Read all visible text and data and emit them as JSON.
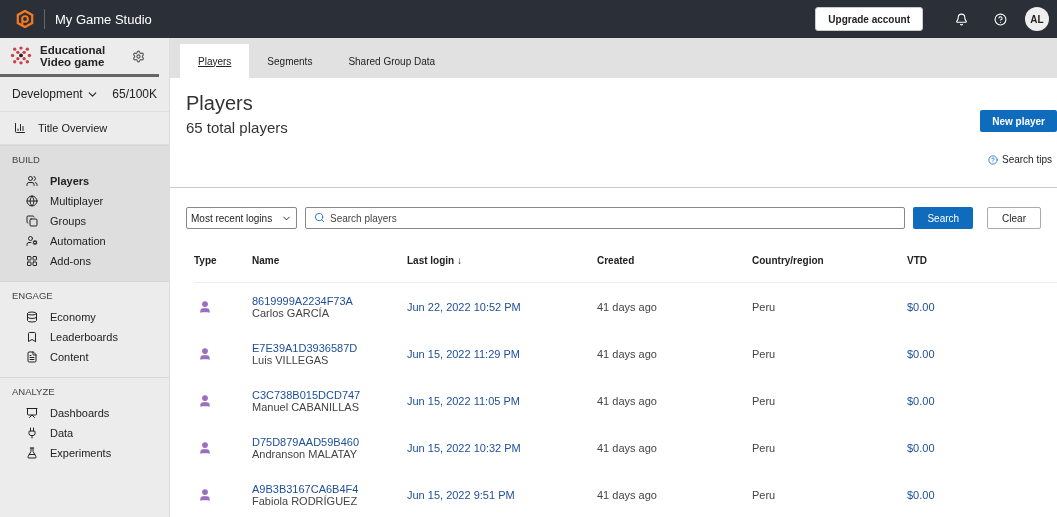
{
  "topbar": {
    "studio": "My Game Studio",
    "upgrade": "Upgrade account",
    "avatar": "AL"
  },
  "sidebar": {
    "game": "Educational Video game",
    "environment": "Development",
    "usage": "65/100K",
    "overview": "Title Overview",
    "sections": [
      {
        "heading": "BUILD",
        "selected": true,
        "items": [
          {
            "label": "Players",
            "selected": true
          },
          {
            "label": "Multiplayer",
            "selected": false
          },
          {
            "label": "Groups",
            "selected": false
          },
          {
            "label": "Automation",
            "selected": false
          },
          {
            "label": "Add-ons",
            "selected": false
          }
        ]
      },
      {
        "heading": "ENGAGE",
        "selected": false,
        "items": [
          {
            "label": "Economy",
            "selected": false
          },
          {
            "label": "Leaderboards",
            "selected": false
          },
          {
            "label": "Content",
            "selected": false
          }
        ]
      },
      {
        "heading": "ANALYZE",
        "selected": false,
        "items": [
          {
            "label": "Dashboards",
            "selected": false
          },
          {
            "label": "Data",
            "selected": false
          },
          {
            "label": "Experiments",
            "selected": false
          }
        ]
      }
    ]
  },
  "tabs": [
    {
      "label": "Players",
      "selected": true
    },
    {
      "label": "Segments",
      "selected": false
    },
    {
      "label": "Shared Group Data",
      "selected": false
    }
  ],
  "page": {
    "title": "Players",
    "subtitle": "65 total players",
    "new_button": "New player",
    "search_tips": "Search tips"
  },
  "filters": {
    "sort": "Most recent logins",
    "placeholder": "Search players",
    "search_button": "Search",
    "clear_button": "Clear"
  },
  "table": {
    "columns": [
      "Type",
      "Name",
      "Last login ↓",
      "Created",
      "Country/region",
      "VTD"
    ],
    "rows": [
      {
        "id": "8619999A2234F73A",
        "name": "Carlos GARCÍA",
        "last_login": "Jun 22, 2022 10:52 PM",
        "created": "41 days ago",
        "country": "Peru",
        "vtd": "$0.00"
      },
      {
        "id": "E7E39A1D3936587D",
        "name": "Luis VILLEGAS",
        "last_login": "Jun 15, 2022 11:29 PM",
        "created": "41 days ago",
        "country": "Peru",
        "vtd": "$0.00"
      },
      {
        "id": "C3C738B015DCD747",
        "name": "Manuel CABANILLAS",
        "last_login": "Jun 15, 2022 11:05 PM",
        "created": "41 days ago",
        "country": "Peru",
        "vtd": "$0.00"
      },
      {
        "id": "D75D879AAD59B460",
        "name": "Andranson MALATAY",
        "last_login": "Jun 15, 2022 10:32 PM",
        "created": "41 days ago",
        "country": "Peru",
        "vtd": "$0.00"
      },
      {
        "id": "A9B3B3167CA6B4F4",
        "name": "Fabiola RODRÍGUEZ",
        "last_login": "Jun 15, 2022 9:51 PM",
        "created": "41 days ago",
        "country": "Peru",
        "vtd": "$0.00"
      }
    ]
  }
}
